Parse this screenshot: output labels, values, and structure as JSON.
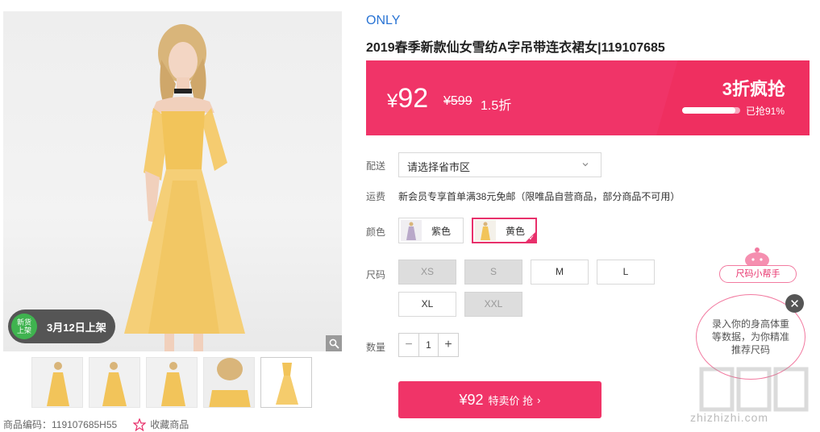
{
  "gallery": {
    "launch_badge_icon_text": "新货上架",
    "launch_badge_icon_line1": "新货",
    "launch_badge_icon_line2": "上架",
    "launch_date": "3月12日上架",
    "thumbnail_count": 5,
    "active_thumbnail": 5
  },
  "meta": {
    "product_code": "商品编码：119107685H55",
    "favorite_label": "收藏商品"
  },
  "product": {
    "brand": "ONLY",
    "title": "2019春季新款仙女雪纺A字吊带连衣裙女|119107685"
  },
  "price": {
    "currency": "¥",
    "current": "92",
    "original": "¥599",
    "discount": "1.5折",
    "promo_label": "3折疯抢",
    "sold_text": "已抢91%",
    "sold_fraction": 0.91
  },
  "delivery": {
    "label": "配送",
    "placeholder": "请选择省市区"
  },
  "shipping": {
    "label": "运费",
    "text": "新会员专享首单满38元免邮（限唯品自营商品，部分商品不可用）"
  },
  "color": {
    "label": "颜色",
    "options": [
      {
        "name": "紫色",
        "selected": false
      },
      {
        "name": "黄色",
        "selected": true
      }
    ]
  },
  "size": {
    "label": "尺码",
    "options": [
      {
        "name": "XS",
        "available": false
      },
      {
        "name": "S",
        "available": false
      },
      {
        "name": "M",
        "available": true
      },
      {
        "name": "L",
        "available": true
      },
      {
        "name": "XL",
        "available": true
      },
      {
        "name": "XXL",
        "available": false
      }
    ]
  },
  "quantity": {
    "label": "数量",
    "value": "1",
    "minus": "−",
    "plus": "+"
  },
  "buy": {
    "price": "¥92",
    "label": "特卖价 抢",
    "arrow": "›"
  },
  "helper": {
    "tag": "尺码小帮手",
    "bubble_text": "录入你的身高体重等数据，为你精准推荐尺码",
    "close": "✕"
  },
  "watermark": {
    "text": "zhizhizhi.com"
  },
  "colors": {
    "accent": "#f03468",
    "brand_link": "#2a74d4",
    "badge_green": "#3fb34f",
    "dress_yellow": "#f2c45a"
  }
}
